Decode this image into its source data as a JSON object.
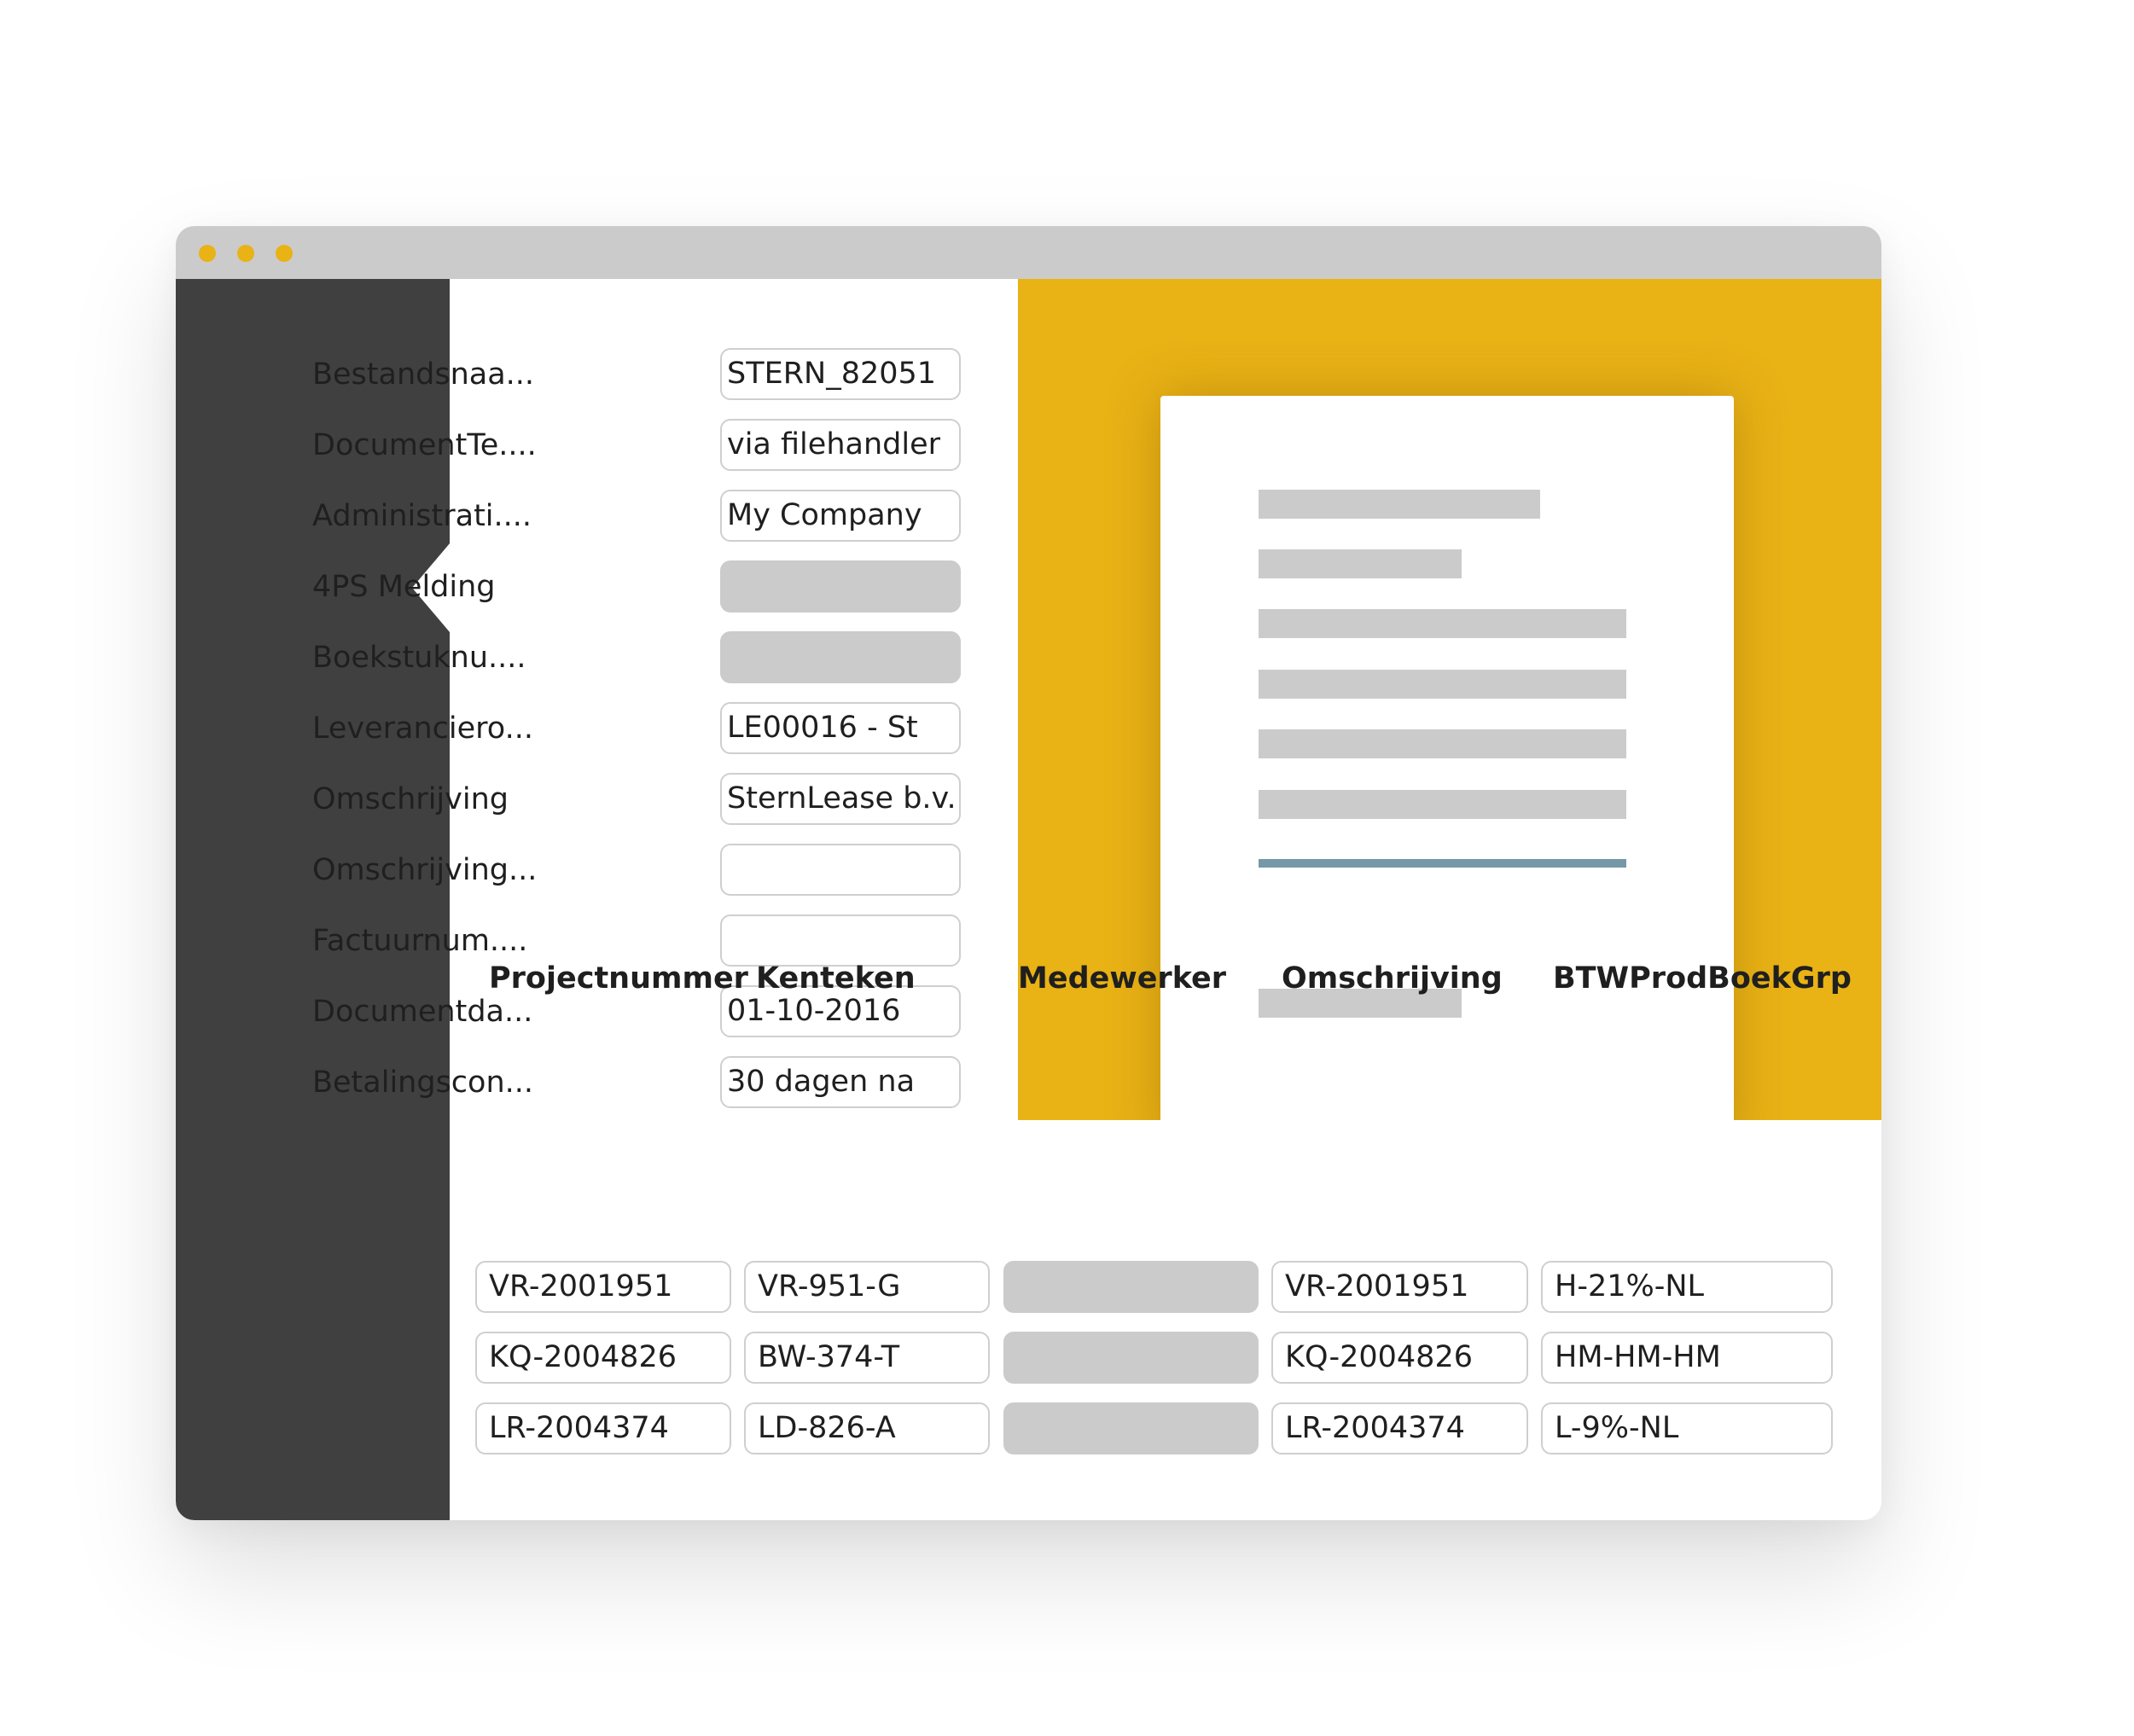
{
  "theme": {
    "accent": "#e9b215",
    "sidebar": "#404040",
    "titlebar": "#cbcbcb",
    "placeholder": "#cbcbcb",
    "accent_line": "#7498a8"
  },
  "window": {
    "dots": [
      "window-dot",
      "window-dot",
      "window-dot"
    ]
  },
  "form": {
    "fields": [
      {
        "label": "Bestandsnaa...",
        "value": "STERN_82051"
      },
      {
        "label": "DocumentTe....",
        "value": "via filehandler"
      },
      {
        "label": "Administrati....",
        "value": "My Company"
      },
      {
        "label": "4PS Melding",
        "value": ""
      },
      {
        "label": "Boekstuknu....",
        "value": ""
      },
      {
        "label": "Leveranciero...",
        "value": "LE00016 - St"
      },
      {
        "label": "Omschrijving",
        "value": "SternLease b.v."
      },
      {
        "label": "Omschrijving...",
        "value": ""
      },
      {
        "label": "Factuurnum....",
        "value": ""
      },
      {
        "label": "Documentda...",
        "value": "01-10-2016"
      },
      {
        "label": "Betalingscon...",
        "value": "30 dagen na"
      }
    ]
  },
  "table": {
    "headers": [
      "Projectnummer",
      "Kenteken",
      "Medewerker",
      "Omschrijving",
      "BTWProdBoekGrp"
    ],
    "rows": [
      [
        "VR-2001951",
        "VR-951-G",
        "",
        "VR-2001951",
        "H-21%-NL"
      ],
      [
        "KQ-2004826",
        "BW-374-T",
        "",
        "KQ-2004826",
        "HM-HM-HM"
      ],
      [
        "LR-2004374",
        "LD-826-A",
        "",
        "LR-2004374",
        "L-9%-NL"
      ]
    ]
  }
}
